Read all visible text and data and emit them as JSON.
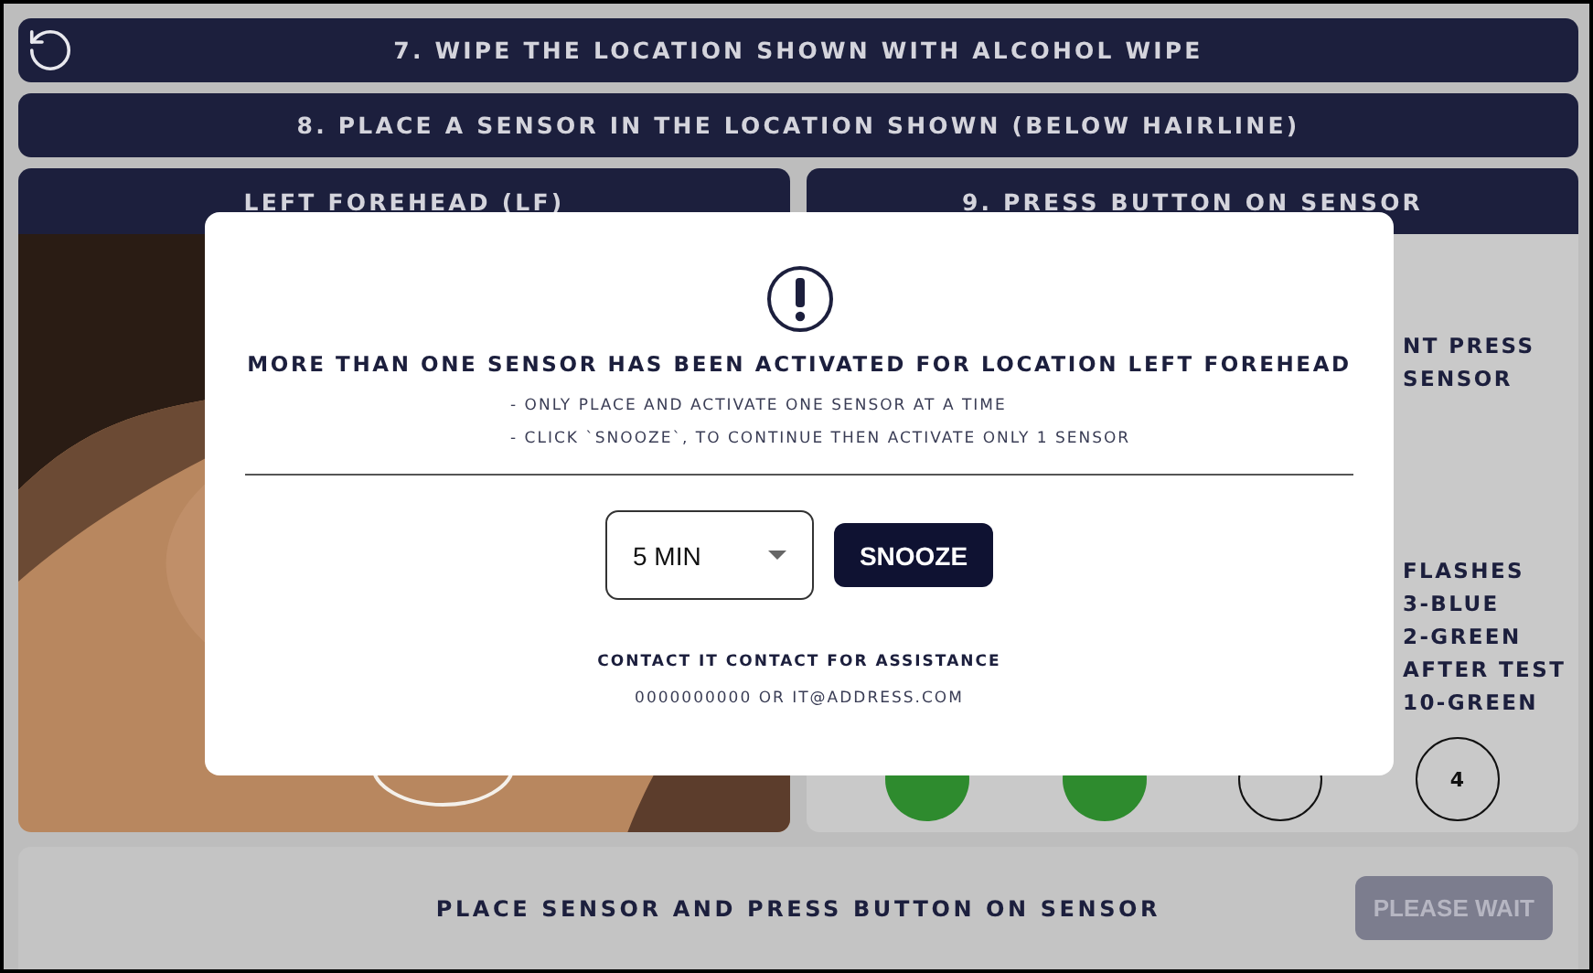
{
  "header_steps": [
    {
      "text": "7. WIPE THE LOCATION SHOWN WITH ALCOHOL WIPE"
    },
    {
      "text": "8. PLACE A SENSOR IN THE LOCATION SHOWN (BELOW HAIRLINE)"
    }
  ],
  "location_panel": {
    "title": "LEFT FOREHEAD (LF)"
  },
  "sensor_panel": {
    "title": "9. PRESS BUTTON ON SENSOR",
    "instruction_lines": [
      "NT PRESS",
      "SENSOR"
    ],
    "status_lines": [
      "FLASHES",
      "3-BLUE",
      "2-GREEN",
      "AFTER TEST",
      "10-GREEN"
    ],
    "steps": [
      {
        "done": true
      },
      {
        "done": true
      },
      {
        "done": false
      },
      {
        "label": "4",
        "done": false
      }
    ]
  },
  "footer": {
    "message": "PLACE SENSOR AND PRESS BUTTON ON SENSOR",
    "button": {
      "label": "PLEASE WAIT",
      "disabled": true
    }
  },
  "dialog": {
    "title": "MORE THAN ONE SENSOR HAS BEEN ACTIVATED FOR LOCATION LEFT FOREHEAD",
    "lines": [
      "- ONLY PLACE AND ACTIVATE ONE SENSOR AT A TIME",
      "- CLICK `SNOOZE`, TO CONTINUE THEN ACTIVATE ONLY 1 SENSOR"
    ],
    "snooze_select": {
      "value": "5 MIN"
    },
    "snooze_button": "SNOOZE",
    "contact_title": "CONTACT IT CONTACT FOR ASSISTANCE",
    "contact_details": "0000000000 OR IT@ADDRESS.COM"
  }
}
